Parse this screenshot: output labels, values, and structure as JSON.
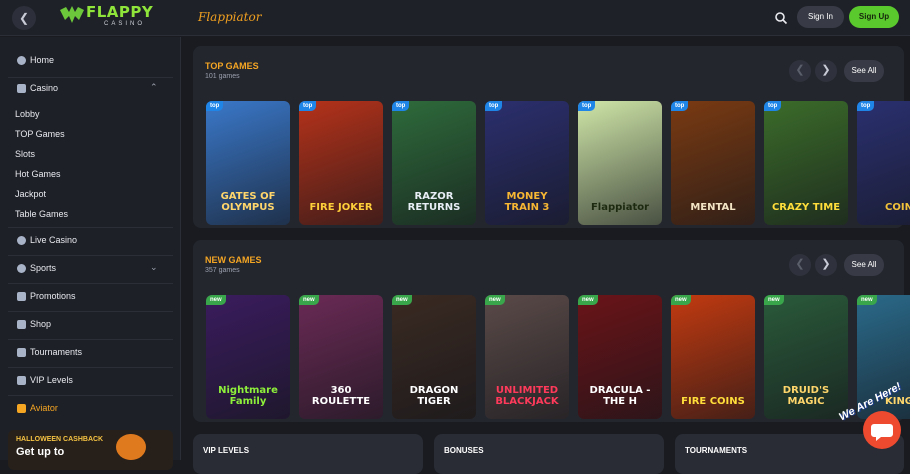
{
  "header": {
    "brand_name": "FLAPPY",
    "brand_sub": "CASINO",
    "partner_logo": "Flappiator",
    "signin_label": "Sign In",
    "signup_label": "Sign Up",
    "back_icon": "chevron-left-icon",
    "search_icon": "search-icon",
    "colors": {
      "accent": "#5ac92d",
      "brand": "#8fe53a",
      "orange": "#f5a623"
    }
  },
  "sidebar": {
    "home": "Home",
    "casino": "Casino",
    "casino_sub": [
      "Lobby",
      "TOP Games",
      "Slots",
      "Hot Games",
      "Jackpot",
      "Table Games"
    ],
    "live_casino": "Live Casino",
    "sports": "Sports",
    "promotions": "Promotions",
    "shop": "Shop",
    "tournaments": "Tournaments",
    "vip_levels": "VIP Levels",
    "aviator": "Aviator",
    "promo_title": "HALLOWEEN CASHBACK",
    "promo_sub": "Get up to"
  },
  "top_games": {
    "title": "TOP GAMES",
    "count": "101 games",
    "see_all": "See All",
    "badge": "top",
    "cards": [
      {
        "name": "Gates of Olympus",
        "caption": "GATES OF OLYMPUS",
        "bg": "#3a78c9",
        "fg": "#ffd66b"
      },
      {
        "name": "Fire Joker",
        "caption": "FIRE JOKER",
        "bg": "#b5321a",
        "fg": "#ffcf3a"
      },
      {
        "name": "Razor Returns",
        "caption": "RAZOR RETURNS",
        "bg": "#2e6b3b",
        "fg": "#e8eef5"
      },
      {
        "name": "Money Train 3",
        "caption": "MONEY TRAIN 3",
        "bg": "#2b2f6e",
        "fg": "#f7b733"
      },
      {
        "name": "Flappiator",
        "caption": "Flappiator",
        "bg": "#cfe6a8",
        "fg": "#1d2a10"
      },
      {
        "name": "Mental",
        "caption": "MENTAL",
        "bg": "#7a3a12",
        "fg": "#f2e4c4"
      },
      {
        "name": "Crazy Time",
        "caption": "CRAZY TIME",
        "bg": "#3b6c2a",
        "fg": "#ffde3b"
      },
      {
        "name": "Coins",
        "caption": "COIN",
        "bg": "#2a3070",
        "fg": "#f2c23a"
      }
    ]
  },
  "new_games": {
    "title": "NEW GAMES",
    "count": "357 games",
    "see_all": "See All",
    "badge": "new",
    "cards": [
      {
        "name": "Nightmare Family Megaways",
        "caption": "Nightmare Family",
        "bg": "#3a1c5e",
        "fg": "#8ef03a"
      },
      {
        "name": "360 Roulette",
        "caption": "360 ROULETTE",
        "bg": "#6a2a55",
        "fg": "#ffffff"
      },
      {
        "name": "Dragon Tiger",
        "caption": "DRAGON TIGER",
        "bg": "#3a2a22",
        "fg": "#ffffff"
      },
      {
        "name": "Unlimited Blackjack",
        "caption": "UNLIMITED BLACKJACK",
        "bg": "#5a4a48",
        "fg": "#ff3a5a"
      },
      {
        "name": "Dracula The Hunt",
        "caption": "DRACULA - THE H",
        "bg": "#6a1418",
        "fg": "#ffffff"
      },
      {
        "name": "Fire Coins Hold and Win",
        "caption": "FIRE COINS",
        "bg": "#c23a10",
        "fg": "#ffde3b"
      },
      {
        "name": "Druid's Magic",
        "caption": "DRUID'S MAGIC",
        "bg": "#2a5a3a",
        "fg": "#ffd66b"
      },
      {
        "name": "Kings",
        "caption": "KING",
        "bg": "#2a6a8a",
        "fg": "#ffd66b"
      }
    ]
  },
  "bottom_sections": [
    "VIP LEVELS",
    "BONUSES",
    "TOURNAMENTS"
  ],
  "widget": {
    "label": "We Are Here!",
    "icon": "chat-icon"
  }
}
